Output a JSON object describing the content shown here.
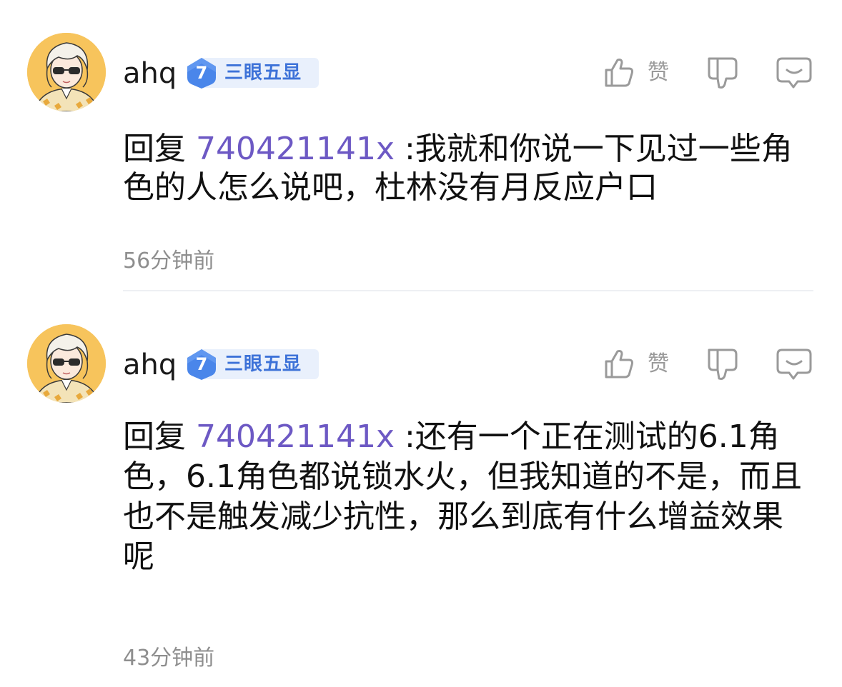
{
  "comments": [
    {
      "username": "ahq",
      "badge": {
        "level": "7",
        "title": "三眼五显"
      },
      "like_label": "赞",
      "reply_prefix": "回复",
      "reply_target": "740421141x",
      "text": " :我就和你说一下见过一些角色的人怎么说吧，杜林没有月反应户口",
      "time": "56分钟前"
    },
    {
      "username": "ahq",
      "badge": {
        "level": "7",
        "title": "三眼五显"
      },
      "like_label": "赞",
      "reply_prefix": "回复",
      "reply_target": "740421141x",
      "text": " :还有一个正在测试的6.1角色，6.1角色都说锁水火，但我知道的不是，而且也不是触发减少抗性，那么到底有什么增益效果呢",
      "time": "43分钟前"
    }
  ],
  "icons": {
    "avatar": "avatar-image",
    "level_badge": "shield-badge-icon",
    "like": "thumbs-up-icon",
    "dislike": "thumbs-down-icon",
    "reply": "comment-bubble-icon"
  },
  "colors": {
    "reply_target": "#6d59c4",
    "badge_text": "#3d72d8",
    "badge_bg": "#e9f0fc",
    "badge_shield": "#4a86ea",
    "meta_gray": "#8e8e8e",
    "avatar_bg": "#f7c45c"
  }
}
